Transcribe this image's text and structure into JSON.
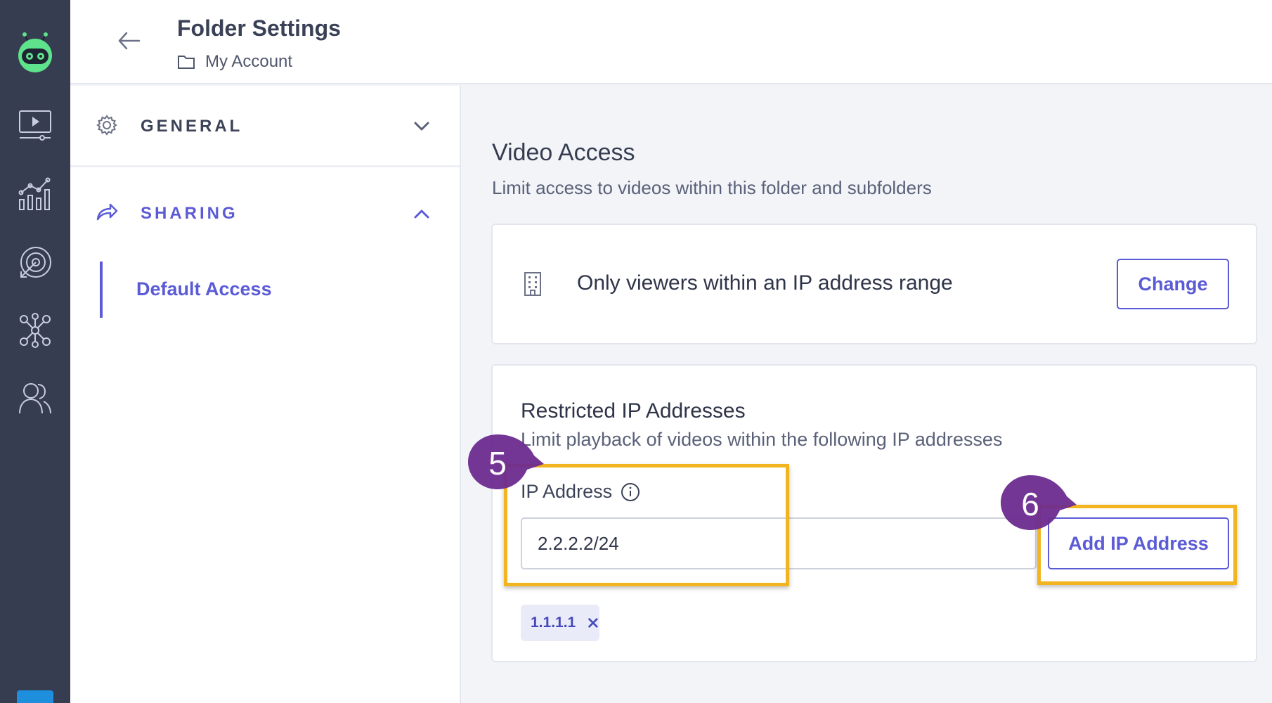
{
  "header": {
    "title": "Folder Settings",
    "breadcrumb": "My Account"
  },
  "rail": {
    "items": [
      "logo-icon",
      "video-library-icon",
      "analytics-icon",
      "target-icon",
      "integrations-icon",
      "users-icon"
    ]
  },
  "sidebar": {
    "general_label": "GENERAL",
    "sharing_label": "SHARING",
    "sharing_items": [
      {
        "label": "Default Access",
        "active": true
      }
    ]
  },
  "video_access": {
    "title": "Video Access",
    "subtitle": "Limit access to videos within this folder and subfolders",
    "current_setting": "Only viewers within an IP address range",
    "change_label": "Change"
  },
  "restricted_ip": {
    "title": "Restricted IP Addresses",
    "subtitle": "Limit playback of videos within the following IP addresses",
    "field_label": "IP Address",
    "input_value": "2.2.2.2/24",
    "add_label": "Add IP Address",
    "entries": [
      "1.1.1.1"
    ]
  },
  "annotations": {
    "step_a": "5",
    "step_b": "6"
  },
  "colors": {
    "accent": "#5b5bd6",
    "rail": "#363d50",
    "highlight": "#f2b520",
    "callout": "#6d2b8f"
  }
}
